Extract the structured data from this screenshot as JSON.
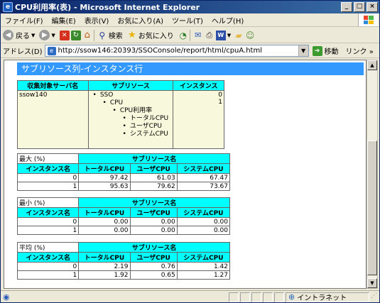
{
  "window": {
    "title": "CPU利用率(表) - Microsoft Internet Explorer",
    "controls": {
      "minimize": "_",
      "maximize": "□",
      "close": "×"
    }
  },
  "menu": [
    "ファイル(F)",
    "編集(E)",
    "表示(V)",
    "お気に入り(A)",
    "ツール(T)",
    "ヘルプ(H)"
  ],
  "toolbar": {
    "back_label": "戻る",
    "search_label": "検索",
    "favorites_label": "お気に入り"
  },
  "address": {
    "label": "アドレス(D)",
    "url": "http://ssow146:20393/SSOConsole/report/html/cpuA.html",
    "go_label": "移動",
    "links_label": "リンク »"
  },
  "status": {
    "text": "",
    "zone": "イントラネット"
  },
  "report": {
    "header": "サブリソース列-インスタンス行",
    "tree_table": {
      "headers": [
        "収集対象サーバ名",
        "サブリソース",
        "インスタンス"
      ],
      "server": "ssow140",
      "tree": [
        {
          "level": 1,
          "label": "SSO"
        },
        {
          "level": 2,
          "label": "CPU"
        },
        {
          "level": 3,
          "label": "CPU利用率"
        },
        {
          "level": 4,
          "label": "トータルCPU"
        },
        {
          "level": 4,
          "label": "ユーザCPU"
        },
        {
          "level": 4,
          "label": "システムCPU"
        }
      ],
      "instances": [
        "0",
        "1"
      ]
    },
    "stats": [
      {
        "caption": "最大 (%)",
        "group_header": "サブリソース名",
        "columns": [
          "インスタンス名",
          "トータルCPU",
          "ユーザCPU",
          "システムCPU"
        ],
        "rows": [
          [
            "0",
            "97.42",
            "61.03",
            "67.47"
          ],
          [
            "1",
            "95.63",
            "79.62",
            "73.67"
          ]
        ]
      },
      {
        "caption": "最小 (%)",
        "group_header": "サブリソース名",
        "columns": [
          "インスタンス名",
          "トータルCPU",
          "ユーザCPU",
          "システムCPU"
        ],
        "rows": [
          [
            "0",
            "0.00",
            "0.00",
            "0.00"
          ],
          [
            "1",
            "0.00",
            "0.00",
            "0.00"
          ]
        ]
      },
      {
        "caption": "平均 (%)",
        "group_header": "サブリソース名",
        "columns": [
          "インスタンス名",
          "トータルCPU",
          "ユーザCPU",
          "システムCPU"
        ],
        "rows": [
          [
            "0",
            "2.19",
            "0.76",
            "1.42"
          ],
          [
            "1",
            "1.92",
            "0.65",
            "1.27"
          ]
        ]
      }
    ]
  }
}
